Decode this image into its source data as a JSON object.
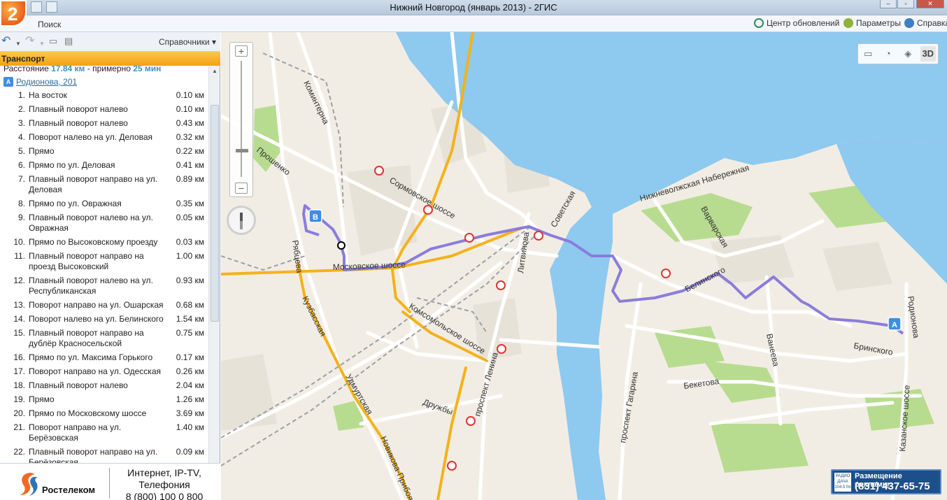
{
  "window": {
    "title": "Нижний Новгород (январь 2013) - 2ГИС",
    "logo_text": "2"
  },
  "menu": {
    "search": "Поиск",
    "update_center": "Центр обновлений",
    "parameters": "Параметры",
    "help": "Справка"
  },
  "left_panel": {
    "directories": "Справочники",
    "section": "Транспорт",
    "summary": {
      "prefix": "Расстояние",
      "distance": "17.84 км",
      "middle": "- примерно",
      "duration": "25 мин"
    },
    "start_address": "Родионова, 201",
    "start_marker": "A",
    "steps": [
      {
        "num": "1.",
        "text": "На восток",
        "dist": "0.10 км"
      },
      {
        "num": "2.",
        "text": "Плавный поворот налево",
        "dist": "0.10 км"
      },
      {
        "num": "3.",
        "text": "Плавный поворот налево",
        "dist": "0.43 км"
      },
      {
        "num": "4.",
        "text": "Поворот налево на ул. Деловая",
        "dist": "0.32 км"
      },
      {
        "num": "5.",
        "text": "Прямо",
        "dist": "0.22 км"
      },
      {
        "num": "6.",
        "text": "Прямо по ул. Деловая",
        "dist": "0.41 км"
      },
      {
        "num": "7.",
        "text": "Плавный поворот направо на ул. Деловая",
        "dist": "0.89 км"
      },
      {
        "num": "8.",
        "text": "Прямо по ул. Овражная",
        "dist": "0.35 км"
      },
      {
        "num": "9.",
        "text": "Плавный поворот налево на ул. Овражная",
        "dist": "0.05 км"
      },
      {
        "num": "10.",
        "text": "Прямо по Высоковскому проезду",
        "dist": "0.03 км"
      },
      {
        "num": "11.",
        "text": "Плавный поворот направо на проезд Высоковский",
        "dist": "1.00 км"
      },
      {
        "num": "12.",
        "text": "Плавный поворот налево на ул. Республиканская",
        "dist": "0.93 км"
      },
      {
        "num": "13.",
        "text": "Поворот направо на ул. Ошарская",
        "dist": "0.68 км"
      },
      {
        "num": "14.",
        "text": "Поворот налево на ул. Белинского",
        "dist": "1.54 км"
      },
      {
        "num": "15.",
        "text": "Плавный поворот направо на дублёр Красносельской",
        "dist": "0.75 км"
      },
      {
        "num": "16.",
        "text": "Прямо по ул. Максима Горького",
        "dist": "0.17 км"
      },
      {
        "num": "17.",
        "text": "Поворот направо на ул. Одесская",
        "dist": "0.26 км"
      },
      {
        "num": "18.",
        "text": "Плавный поворот налево",
        "dist": "2.04 км"
      },
      {
        "num": "19.",
        "text": "Прямо",
        "dist": "1.26 км"
      },
      {
        "num": "20.",
        "text": "Прямо по Московскому шоссе",
        "dist": "3.69 км"
      },
      {
        "num": "21.",
        "text": "Поворот направо на ул. Берёзовская",
        "dist": "1.40 км"
      },
      {
        "num": "22.",
        "text": "Плавный поворот направо на ул. Берёзовская",
        "dist": "0.09 км"
      }
    ]
  },
  "ad": {
    "brand": "Ростелеком",
    "line1": "Интернет, IP-TV,",
    "line2": "Телефония",
    "line3": "8 (800) 100 0 800"
  },
  "map": {
    "tool_3d": "3D",
    "marker_a": "A",
    "marker_b": "B",
    "banner_radio": "РАДИО ДАЧА 104.5 fm",
    "banner_title": "Размещение рекламы:",
    "banner_phone": "(831) 437-65-75",
    "streets": {
      "kominterna": "Коминтерна",
      "proshenko": "Прошенко",
      "ryabtseva": "Рябцева",
      "sormovskoe": "Сормовское шоссе",
      "moskovskoe": "Московское шоссе",
      "kuzbasskaya": "Кузбасская",
      "udmurtskaya": "Удмуртская",
      "komsomolskoe": "Комсомольское шоссе",
      "druzhby": "Дружбы",
      "novikova": "Новикова-Прибоя",
      "lenina": "проспект Ленина",
      "litvinova": "Литвинова",
      "sovetskaya": "Советская",
      "nabereznaya": "Нижневолжская Набережная",
      "varvarskaya": "Варварская",
      "belinskogo": "Белинского",
      "vaneeva": "Ванеева",
      "beketova": "Бекетова",
      "gagarina": "проспект Гагарина",
      "brinskogo": "Бринского",
      "rodionova": "Родионова",
      "kazanskoe": "Казанское шоссе"
    }
  },
  "colors": {
    "water": "#8ec9ef",
    "route": "#8a7ddb",
    "highway": "#f4b21b",
    "park": "#b7dc8f",
    "header": "#f2a114"
  }
}
